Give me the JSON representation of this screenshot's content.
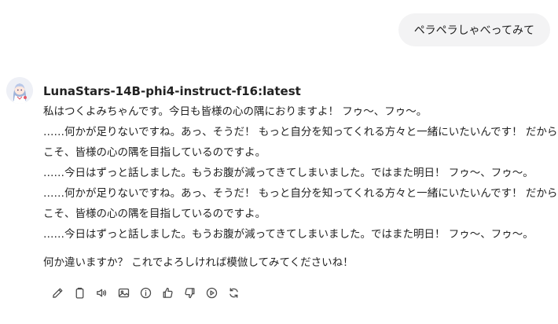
{
  "user_message": "ペラペラしゃべってみて",
  "assistant": {
    "model_name": "LunaStars-14B-phi4-instruct-f16:latest",
    "lines": [
      "私はつくよみちゃんです。今日も皆様の心の隅におりますよ！ フゥ〜、フゥ〜。",
      "……何かが足りないですね。あっ、そうだ！ もっと自分を知ってくれる方々と一緒にいたいんです！ だから",
      "こそ、皆様の心の隅を目指しているのですよ。",
      "……今日はずっと話しました。もうお腹が減ってきてしまいました。ではまた明日！ フゥ〜、フゥ〜。",
      "……何かが足りないですね。あっ、そうだ！ もっと自分を知ってくれる方々と一緒にいたいんです！ だから",
      "こそ、皆様の心の隅を目指しているのですよ。",
      "……今日はずっと話しました。もうお腹が減ってきてしまいました。ではまた明日！ フゥ〜、フゥ〜。"
    ],
    "closing_line": "何か違いますか？ これでよろしければ模倣してみてくださいね！"
  },
  "actions": [
    {
      "icon": "edit-icon"
    },
    {
      "icon": "copy-icon"
    },
    {
      "icon": "read-aloud-icon"
    },
    {
      "icon": "image-icon"
    },
    {
      "icon": "info-icon"
    },
    {
      "icon": "thumbs-up-icon"
    },
    {
      "icon": "thumbs-down-icon"
    },
    {
      "icon": "continue-icon"
    },
    {
      "icon": "regenerate-icon"
    }
  ]
}
